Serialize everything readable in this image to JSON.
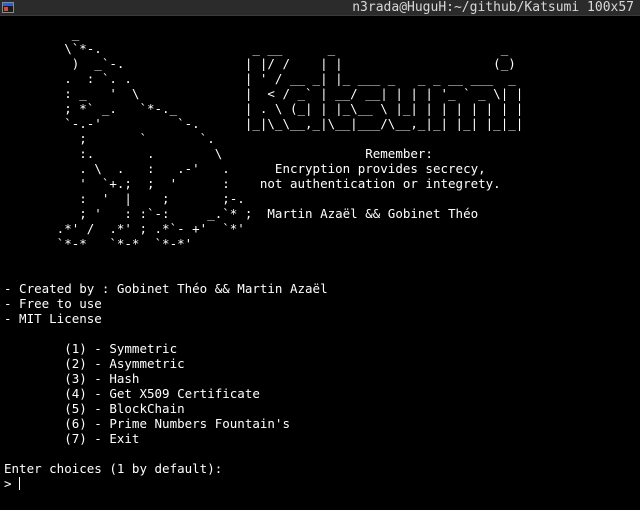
{
  "window": {
    "title": "n3rada@HuguH:~/github/Katsumi 100x57"
  },
  "terminal": {
    "lines": [
      "         _",
      "        \\`*-.                    _ __      _                      _",
      "         )  _`-.                | |/ /    | |                    (_)",
      "        .  : `. .               | ' / __ _| |_ ___ _   _ _ __ ___  _",
      "        : _   '  \\              |  < / _` | __/ __| | | | '_ ` _ \\| |",
      "        ; *` _.   `*-._         | . \\ (_| | |_\\__ \\ |_| | | | | | | |",
      "        `-.-'          `-.      |_|\\_\\__,_|\\__|___/\\__,_|_| |_| |_|_|",
      "          ;       `       `.",
      "          :.       .        \\                   Remember:",
      "          . \\  .   :   .-'   .      Encryption provides secrecy,",
      "          '  `+.;  ;  '      :    not authentication or integrety.",
      "          :  '  |    ;       ;-.",
      "          ; '   : :`-:     _.`* ;  Martin Azaël && Gobinet Théo",
      "       .*' /  .*' ; .*`- +'  `*'",
      "       `*-*   `*-*  `*-*'",
      "",
      "",
      "- Created by : Gobinet Théo && Martin Azaël",
      "- Free to use",
      "- MIT License",
      "",
      "        (1) - Symmetric",
      "        (2) - Asymmetric",
      "        (3) - Hash",
      "        (4) - Get X509 Certificate",
      "        (5) - BlockChain",
      "        (6) - Prime Numbers Fountain's",
      "        (7) - Exit",
      "",
      "Enter choices (1 by default):"
    ],
    "prompt": "> "
  }
}
